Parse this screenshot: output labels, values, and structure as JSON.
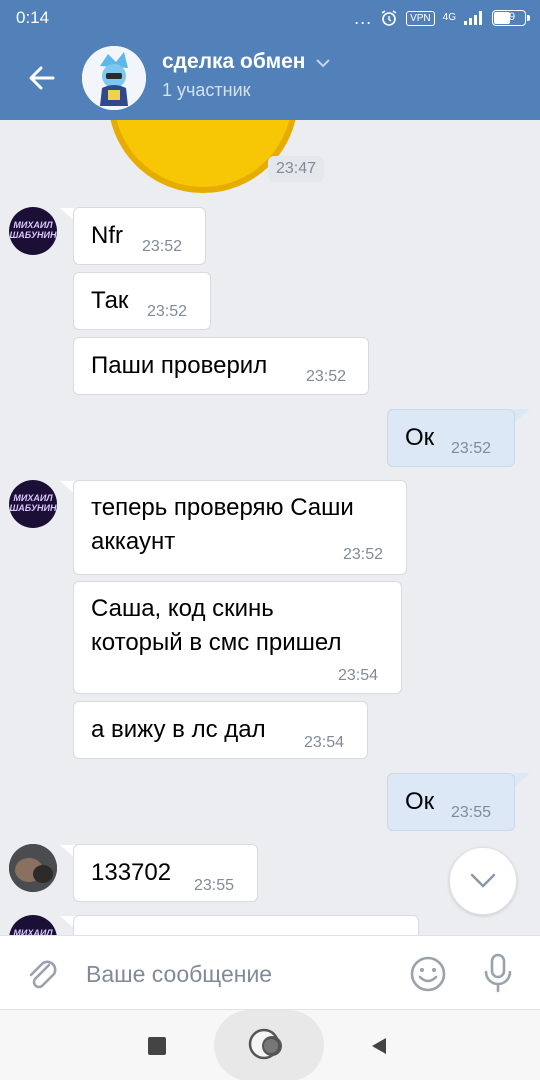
{
  "status_bar": {
    "time": "0:14",
    "dots": "...",
    "vpn": "VPN",
    "network": "4G",
    "battery": "49"
  },
  "header": {
    "back_icon": "arrow-left-icon",
    "title": "сделка обмен",
    "subtitle": "1 участник"
  },
  "messages": {
    "sticker_time": "23:47",
    "items": [
      {
        "text": "Nfr",
        "time": "23:52",
        "direction": "in"
      },
      {
        "text": "Так",
        "time": "23:52",
        "direction": "in"
      },
      {
        "text": "Паши проверил",
        "time": "23:52",
        "direction": "in"
      },
      {
        "text": "Ок",
        "time": "23:52",
        "direction": "out"
      },
      {
        "text_line1": "теперь проверяю Саши",
        "text_line2": "аккаунт",
        "time": "23:52",
        "direction": "in"
      },
      {
        "text_line1": "Саша, код скинь",
        "text_line2": "который в смс пришел",
        "time": "23:54",
        "direction": "in"
      },
      {
        "text": "а вижу в лс дал",
        "time": "23:54",
        "direction": "in"
      },
      {
        "text": "Ок",
        "time": "23:55",
        "direction": "out"
      },
      {
        "text": "133702",
        "time": "23:55",
        "direction": "in"
      }
    ],
    "avatar_label_line1": "МИХАИЛ",
    "avatar_label_line2": "ШАБУНИН"
  },
  "compose": {
    "placeholder": "Ваше сообщение",
    "attach_icon": "paperclip-icon",
    "emoji_icon": "smiley-icon",
    "mic_icon": "microphone-icon"
  },
  "colors": {
    "header": "#5181b8",
    "background": "#ebedf0",
    "outgoing_bubble": "#dce8f6",
    "incoming_bubble": "#ffffff",
    "timestamp": "#828a99"
  }
}
